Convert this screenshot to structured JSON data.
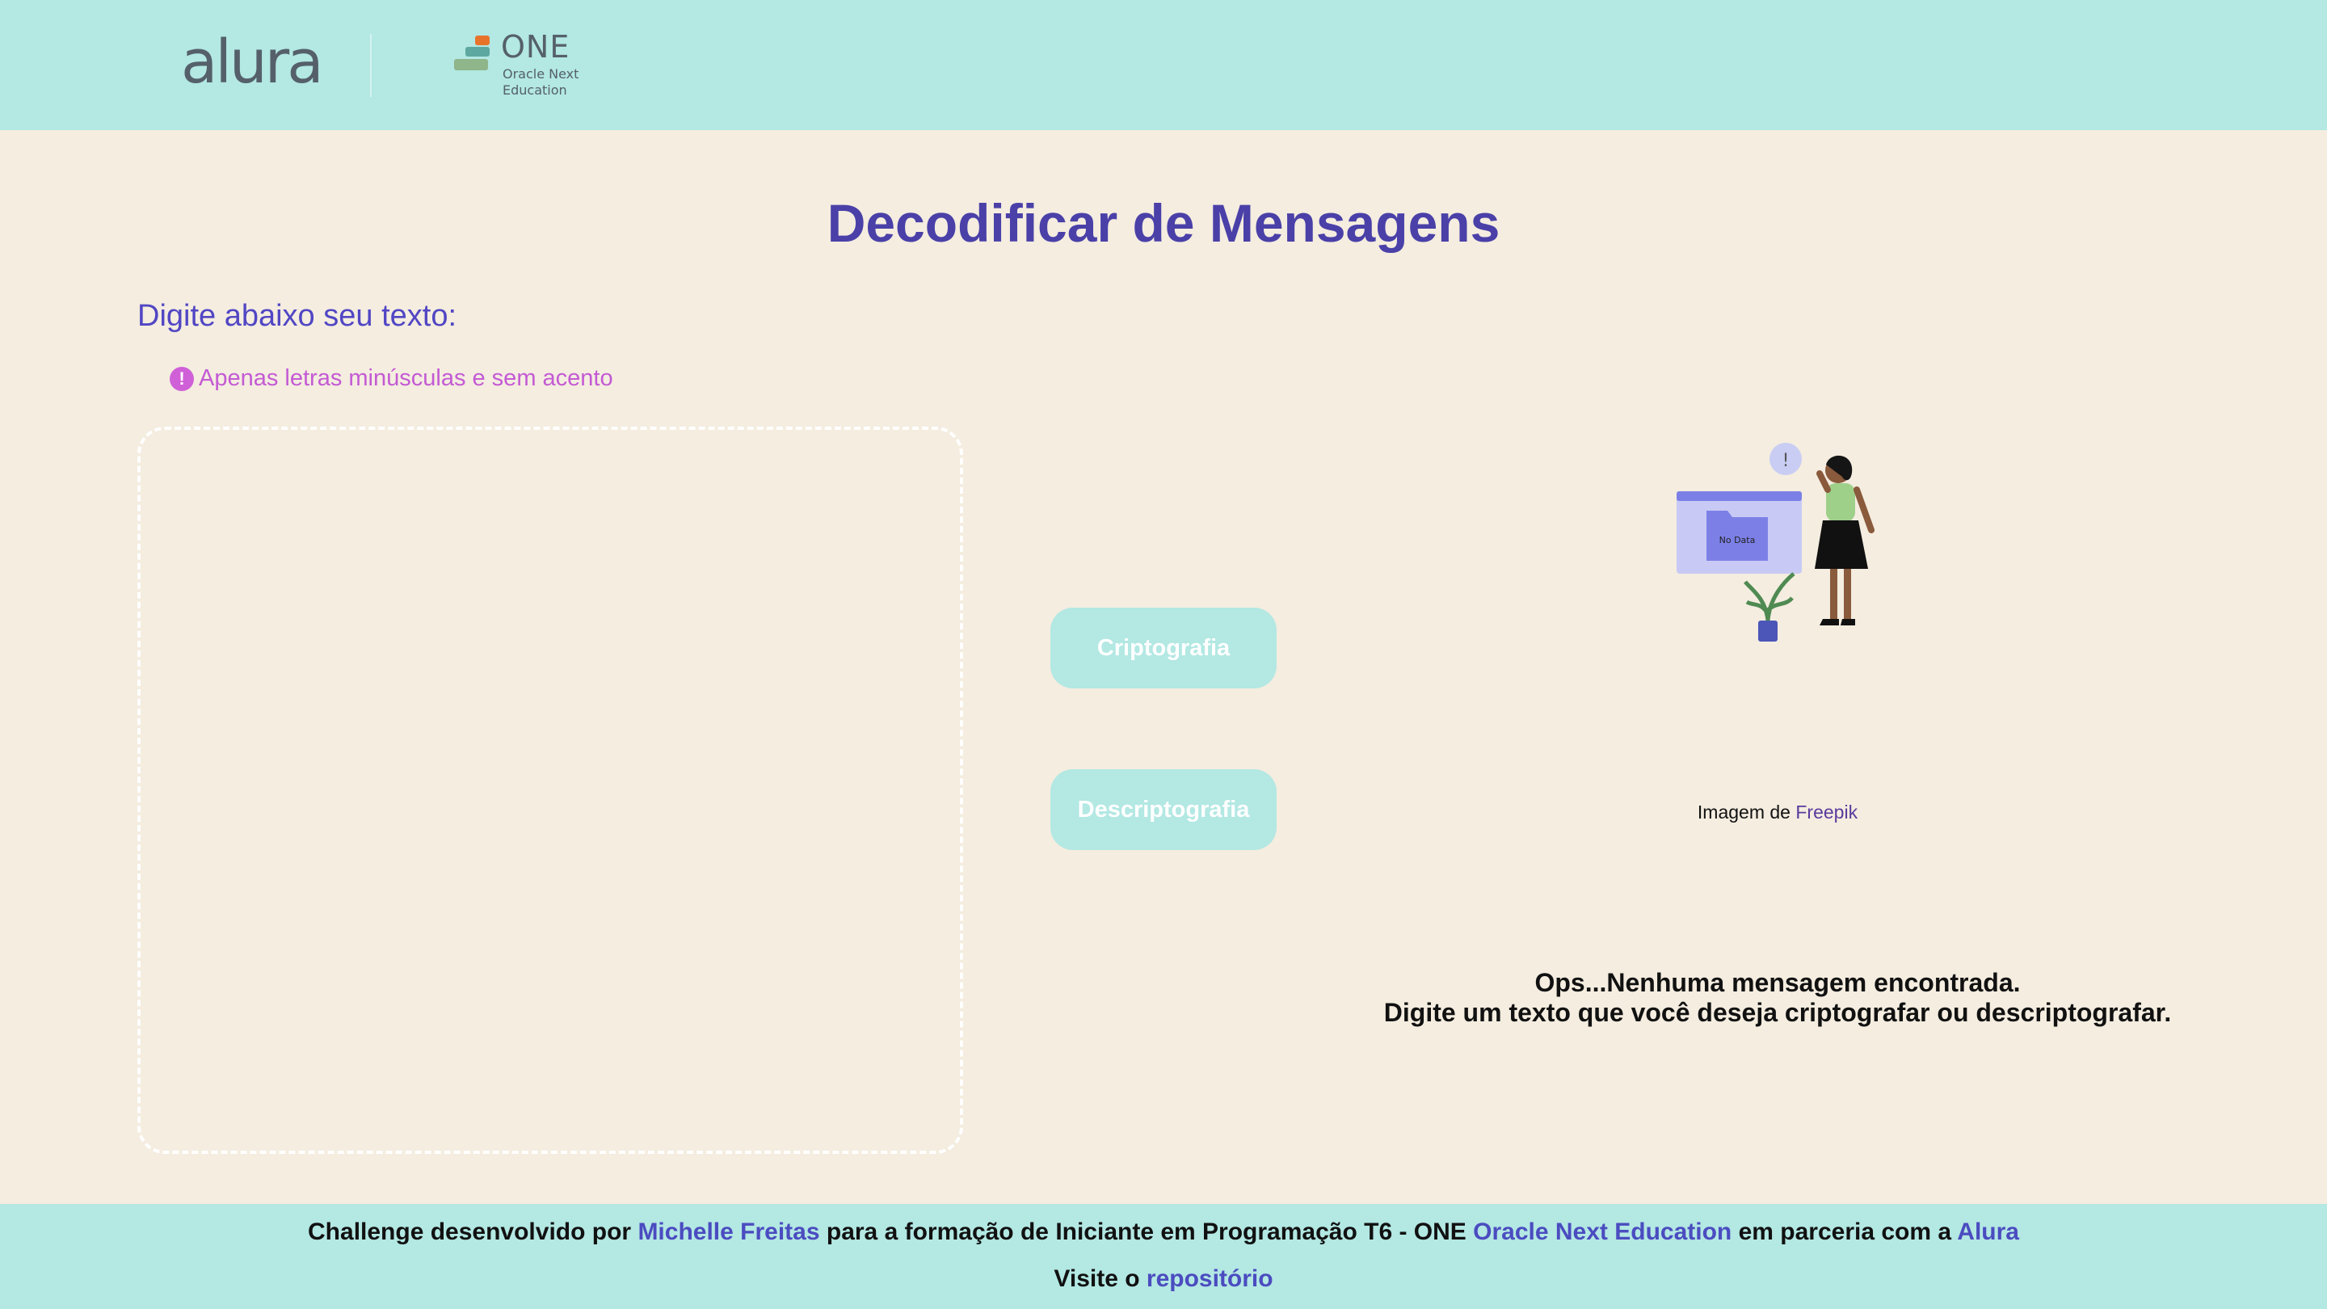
{
  "header": {
    "alura_logo": "alura",
    "one_logo": {
      "title": "ONE",
      "sub_line1": "Oracle Next",
      "sub_line2": "Education"
    }
  },
  "main": {
    "title": "Decodificar de Mensagens",
    "input_label": "Digite abaixo seu texto:",
    "hint_icon": "!",
    "hint": "Apenas letras minúsculas e sem acento",
    "textarea_value": "",
    "buttons": {
      "encrypt": "Criptografia",
      "decrypt": "Descriptografia"
    }
  },
  "output": {
    "illustration_label": "No Data",
    "credit_prefix": "Imagem de",
    "credit_link": "Freepik",
    "empty_line1": "Ops...Nenhuma mensagem encontrada.",
    "empty_line2": "Digite um texto que você deseja criptografar ou descriptografar."
  },
  "footer": {
    "t1": "Challenge desenvolvido por ",
    "author": "Michelle Freitas",
    "t2": " para a formação de Iniciante em Programação T6 - ONE ",
    "one_link": "Oracle Next Education",
    "t3": " em parceria com a ",
    "alura_link": "Alura",
    "visit_prefix": "Visite o ",
    "repo_link": "repositório"
  },
  "colors": {
    "header_bg": "#b3e8e3",
    "page_bg": "#f4ede0",
    "title": "#4a40a8",
    "hint": "#c45ad4",
    "link": "#4b4cc0"
  }
}
